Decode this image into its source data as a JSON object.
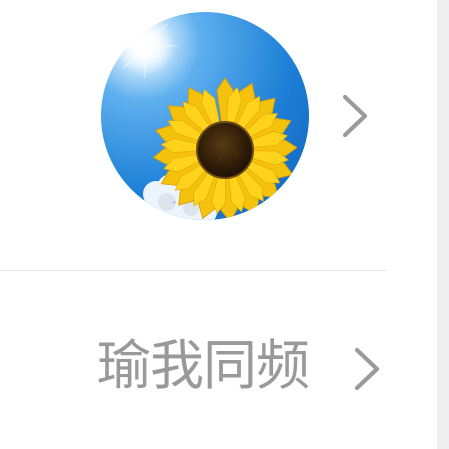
{
  "profile": {
    "avatar_icon": "sunflower-avatar",
    "nickname": "瑜我同频",
    "chevron_icon": "chevron-right-icon"
  },
  "colors": {
    "text_gray": "#999999",
    "chevron_gray": "#9a9a9a",
    "divider": "#e6e6e6",
    "strip": "#efeff2"
  }
}
